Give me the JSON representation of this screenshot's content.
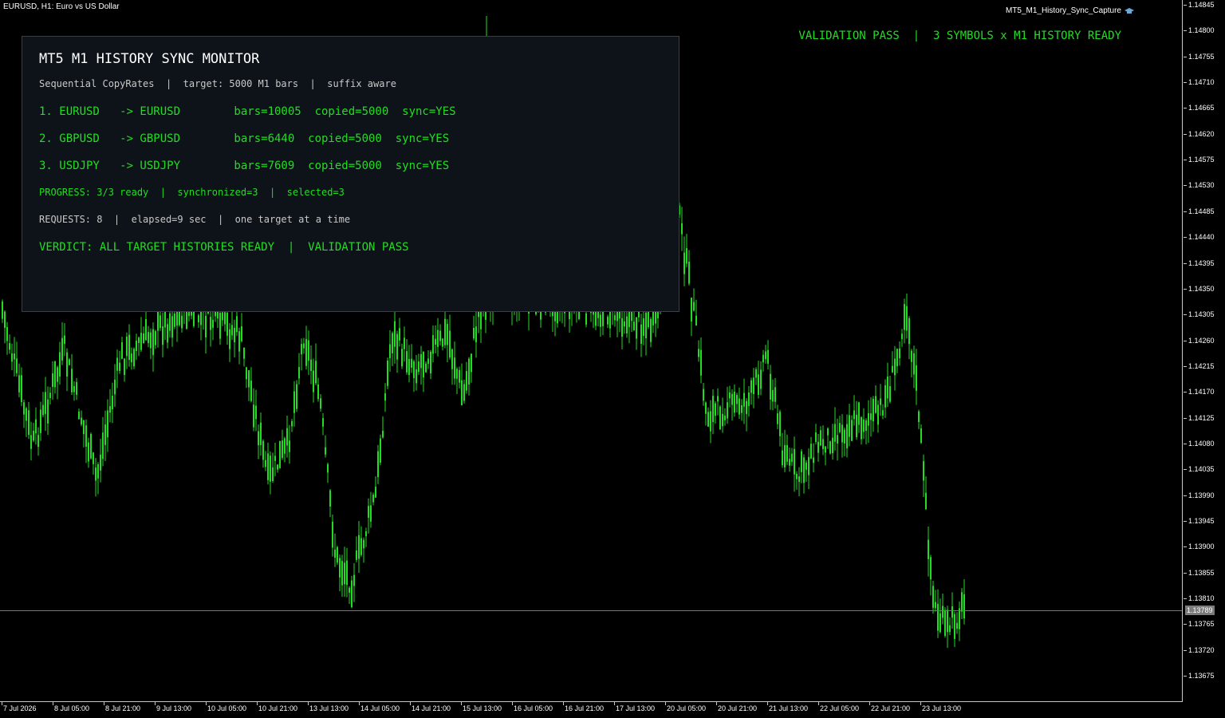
{
  "chart": {
    "title": "EURUSD, H1:  Euro vs US Dollar",
    "capture_label": "MT5_M1_History_Sync_Capture",
    "current_price": "1.13789",
    "candle_color": "#22dd22",
    "price_labels": [
      "1.14845",
      "1.14800",
      "1.14755",
      "1.14710",
      "1.14665",
      "1.14620",
      "1.14575",
      "1.14530",
      "1.14485",
      "1.14440",
      "1.14395",
      "1.14350",
      "1.14305",
      "1.14260",
      "1.14215",
      "1.14170",
      "1.14125",
      "1.14080",
      "1.14035",
      "1.13990",
      "1.13945",
      "1.13900",
      "1.13855",
      "1.13810",
      "1.13765",
      "1.13720",
      "1.13675"
    ],
    "time_labels": [
      "7 Jul 2026",
      "8 Jul 05:00",
      "8 Jul 21:00",
      "9 Jul 13:00",
      "10 Jul 05:00",
      "10 Jul 21:00",
      "13 Jul 13:00",
      "14 Jul 05:00",
      "14 Jul 21:00",
      "15 Jul 13:00",
      "16 Jul 05:00",
      "16 Jul 21:00",
      "17 Jul 13:00",
      "20 Jul 05:00",
      "20 Jul 21:00",
      "21 Jul 13:00",
      "22 Jul 05:00",
      "22 Jul 21:00",
      "23 Jul 13:00"
    ]
  },
  "banner": {
    "text": "VALIDATION PASS  |  3 SYMBOLS x M1 HISTORY READY"
  },
  "panel": {
    "title": "MT5 M1 HISTORY SYNC MONITOR",
    "subtitle": "Sequential CopyRates  |  target: 5000 M1 bars  |  suffix aware",
    "rows": [
      "1. EURUSD   -> EURUSD        bars=10005  copied=5000  sync=YES",
      "2. GBPUSD   -> GBPUSD        bars=6440  copied=5000  sync=YES",
      "3. USDJPY   -> USDJPY        bars=7609  copied=5000  sync=YES"
    ],
    "progress": "PROGRESS: 3/3 ready  |  synchronized=3  |  selected=3",
    "requests": "REQUESTS: 8  |  elapsed=9 sec  |  one target at a time",
    "verdict": "VERDICT: ALL TARGET HISTORIES READY  |  VALIDATION PASS"
  }
}
